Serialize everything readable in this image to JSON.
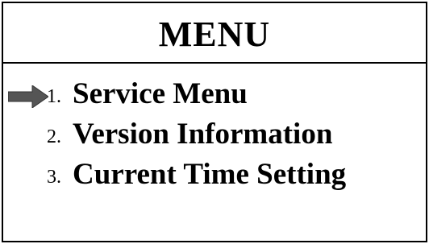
{
  "menu": {
    "title": "MENU",
    "items": [
      {
        "number": "1.",
        "label": "Service Menu",
        "selected": true
      },
      {
        "number": "2.",
        "label": "Version Information",
        "selected": false
      },
      {
        "number": "3.",
        "label": "Current Time Setting",
        "selected": false
      }
    ]
  },
  "cursor": {
    "icon": "selection-arrow-icon",
    "color": "#555555"
  }
}
